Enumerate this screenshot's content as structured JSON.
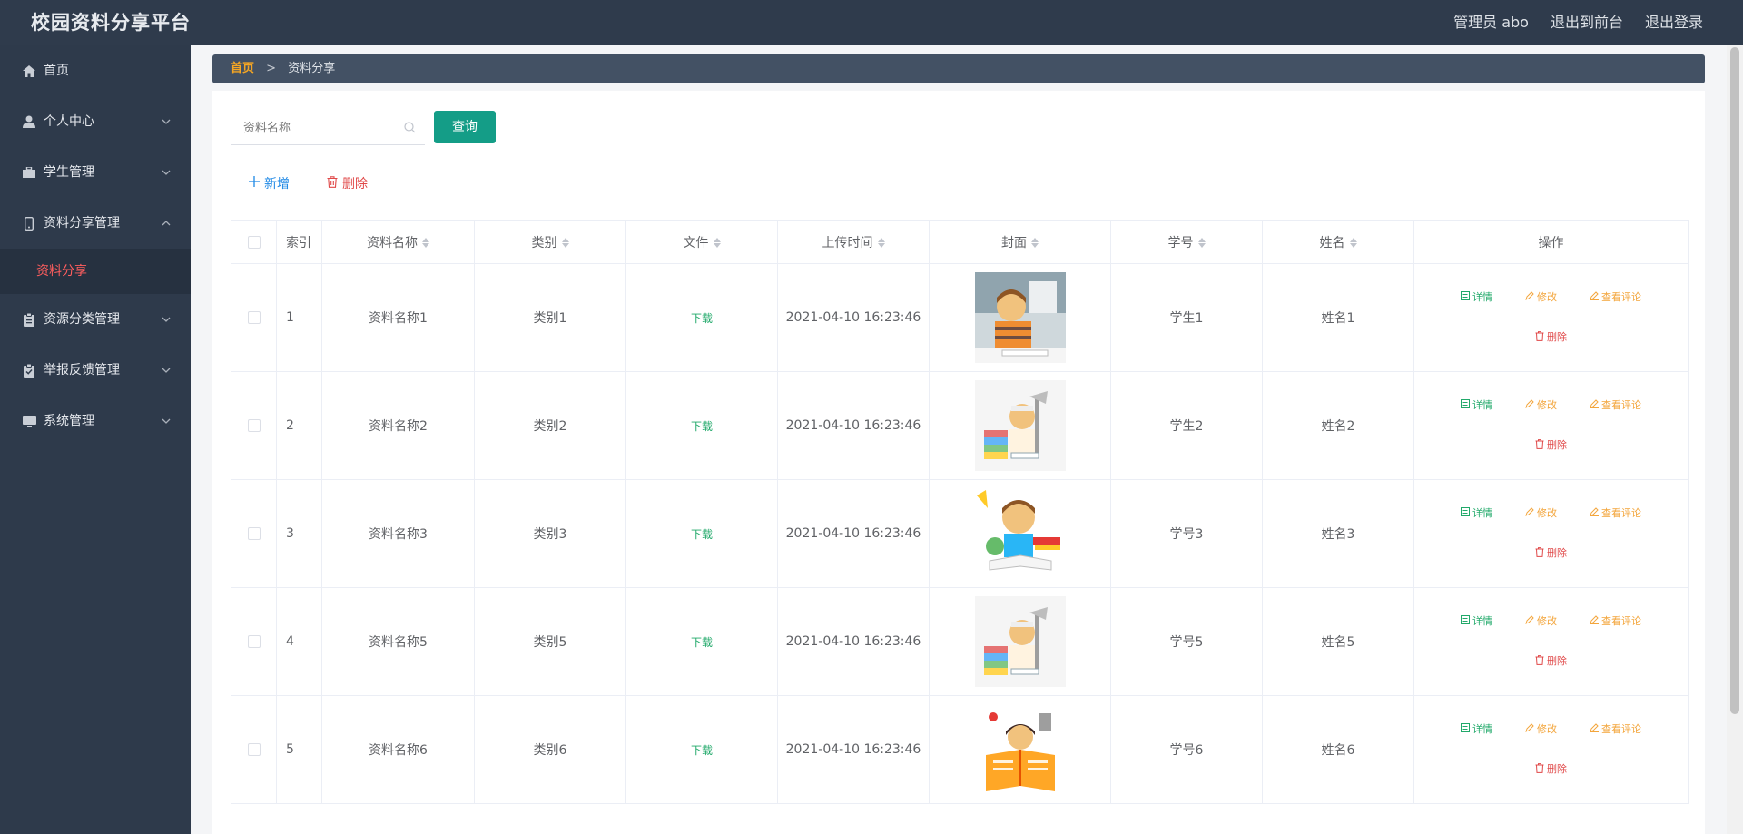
{
  "header": {
    "title": "校园资料分享平台",
    "admin": "管理员 abo",
    "to_front": "退出到前台",
    "logout": "退出登录"
  },
  "sidebar": {
    "items": [
      {
        "label": "首页",
        "icon": "home-icon"
      },
      {
        "label": "个人中心",
        "icon": "user-icon"
      },
      {
        "label": "学生管理",
        "icon": "briefcase-icon"
      },
      {
        "label": "资料分享管理",
        "icon": "mobile-icon"
      },
      {
        "label": "资源分类管理",
        "icon": "clipboard-icon"
      },
      {
        "label": "举报反馈管理",
        "icon": "checklist-icon"
      },
      {
        "label": "系统管理",
        "icon": "monitor-icon"
      }
    ],
    "active_sub": "资料分享"
  },
  "breadcrumb": {
    "home": "首页",
    "sep": ">",
    "current": "资料分享"
  },
  "search": {
    "placeholder": "资料名称",
    "query_label": "查询"
  },
  "toolbar": {
    "add_label": "新增",
    "delete_label": "删除"
  },
  "table": {
    "headers": {
      "index": "索引",
      "name": "资料名称",
      "category": "类别",
      "file": "文件",
      "upload_time": "上传时间",
      "cover": "封面",
      "student_no": "学号",
      "student_name": "姓名",
      "actions": "操作"
    },
    "rows": [
      {
        "index": "1",
        "name": "资料名称1",
        "category": "类别1",
        "file": "下载",
        "upload_time": "2021-04-10 16:23:46",
        "student_no": "学生1",
        "student_name": "姓名1"
      },
      {
        "index": "2",
        "name": "资料名称2",
        "category": "类别2",
        "file": "下载",
        "upload_time": "2021-04-10 16:23:46",
        "student_no": "学生2",
        "student_name": "姓名2"
      },
      {
        "index": "3",
        "name": "资料名称3",
        "category": "类别3",
        "file": "下载",
        "upload_time": "2021-04-10 16:23:46",
        "student_no": "学号3",
        "student_name": "姓名3"
      },
      {
        "index": "4",
        "name": "资料名称5",
        "category": "类别5",
        "file": "下载",
        "upload_time": "2021-04-10 16:23:46",
        "student_no": "学号5",
        "student_name": "姓名5"
      },
      {
        "index": "5",
        "name": "资料名称6",
        "category": "类别6",
        "file": "下载",
        "upload_time": "2021-04-10 16:23:46",
        "student_no": "学号6",
        "student_name": "姓名6"
      }
    ],
    "actions": {
      "detail": "详情",
      "edit": "修改",
      "comment": "查看评论",
      "delete": "删除"
    }
  },
  "colors": {
    "header_bg": "#2f3b4c",
    "sidebar_bg": "#2e3a4b",
    "active_text": "#ff5e5e",
    "query_button": "#149d87",
    "breadcrumb_home": "#f5a623"
  }
}
